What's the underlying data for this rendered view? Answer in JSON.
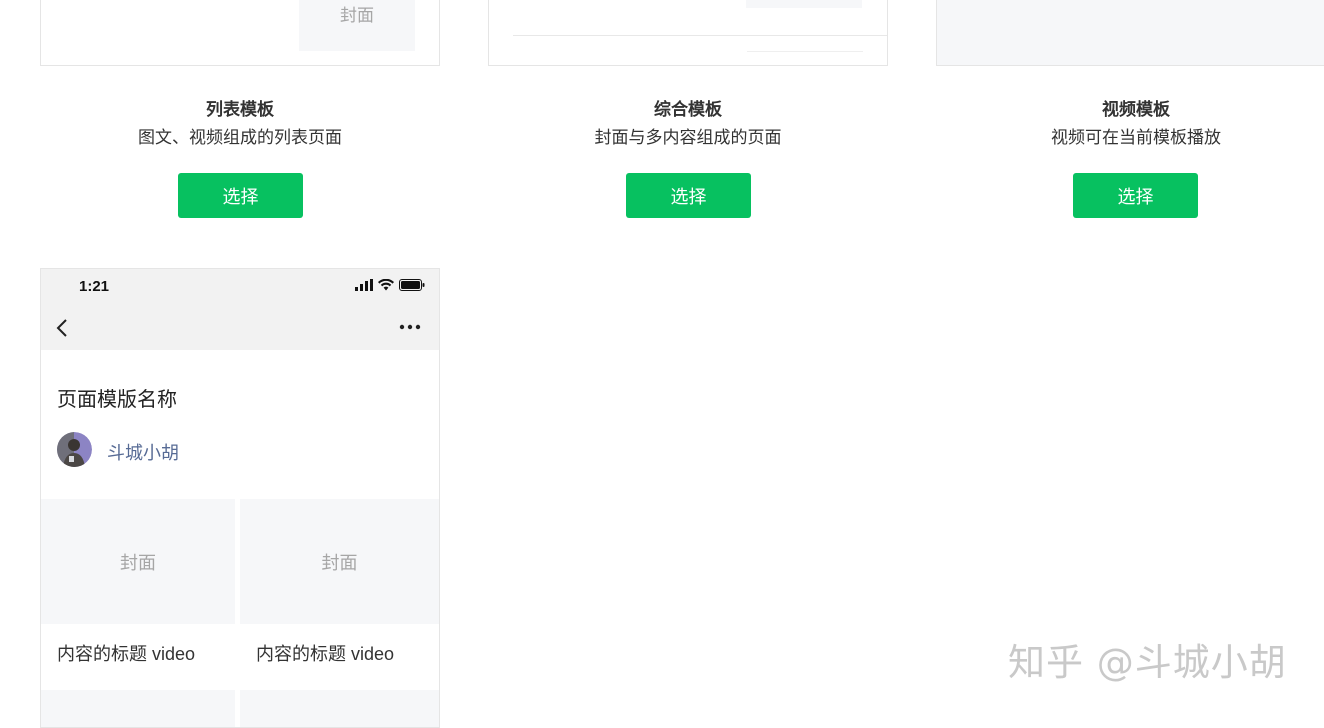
{
  "top_previews": {
    "list_cover_label": "封面"
  },
  "templates": [
    {
      "title": "列表模板",
      "desc": "图文、视频组成的列表页面",
      "button": "选择"
    },
    {
      "title": "综合模板",
      "desc": "封面与多内容组成的页面",
      "button": "选择"
    },
    {
      "title": "视频模板",
      "desc": "视频可在当前模板播放",
      "button": "选择"
    }
  ],
  "phone": {
    "time": "1:21",
    "page_name": "页面模版名称",
    "author": "斗城小胡",
    "items": [
      {
        "cover": "封面",
        "title": "内容的标题 video"
      },
      {
        "cover": "封面",
        "title": "内容的标题 video"
      }
    ]
  },
  "watermark": "知乎 @斗城小胡",
  "colors": {
    "accent": "#07c160",
    "author_link": "#576b95",
    "cover_bg": "#f6f7f9"
  }
}
